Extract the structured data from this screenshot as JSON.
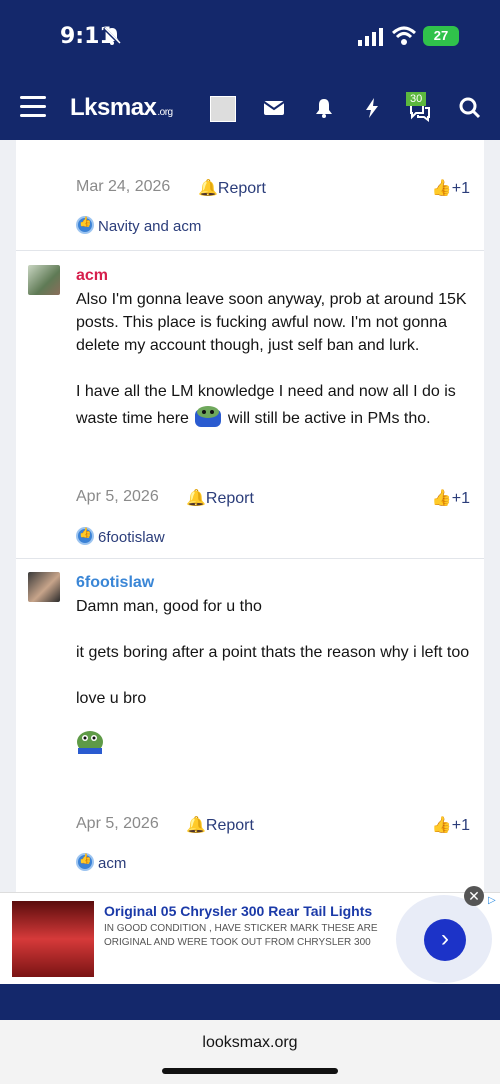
{
  "status_bar": {
    "time": "9:11",
    "battery": "27"
  },
  "nav": {
    "logo": "Lksmax",
    "logo_suffix": ".org",
    "alerts_badge": "30"
  },
  "posts": [
    {
      "date": "Mar 24, 2026",
      "report": "Report",
      "plus": "+1",
      "reactions": "Navity and acm"
    },
    {
      "author": "acm",
      "author_color": "#d61f4c",
      "body_1": "Also I'm gonna leave soon anyway, prob at around 15K posts. This place is fucking awful now. I'm not gonna delete my account though, just self ban and lurk.",
      "body_2a": "I have all the LM knowledge I need and now all I do is waste time here",
      "body_2b": "will still be active in PMs tho.",
      "date": "Apr 5, 2026",
      "report": "Report",
      "plus": "+1",
      "reactions": "6footislaw"
    },
    {
      "author": "6footislaw",
      "author_color": "#3a86d6",
      "body_1": "Damn man, good for u tho",
      "body_2": "it gets boring after a point thats the reason why i left too",
      "body_3": "love u bro",
      "date": "Apr 5, 2026",
      "report": "Report",
      "plus": "+1",
      "reactions": "acm"
    }
  ],
  "ad": {
    "title": "Original 05 Chrysler 300 Rear Tail Lights",
    "description": "IN GOOD CONDITION , HAVE STICKER MARK THESE ARE ORIGINAL AND WERE TOOK OUT FROM Chrysler 300",
    "close": "✕",
    "go": "›"
  },
  "browser": {
    "url": "looksmax.org"
  }
}
